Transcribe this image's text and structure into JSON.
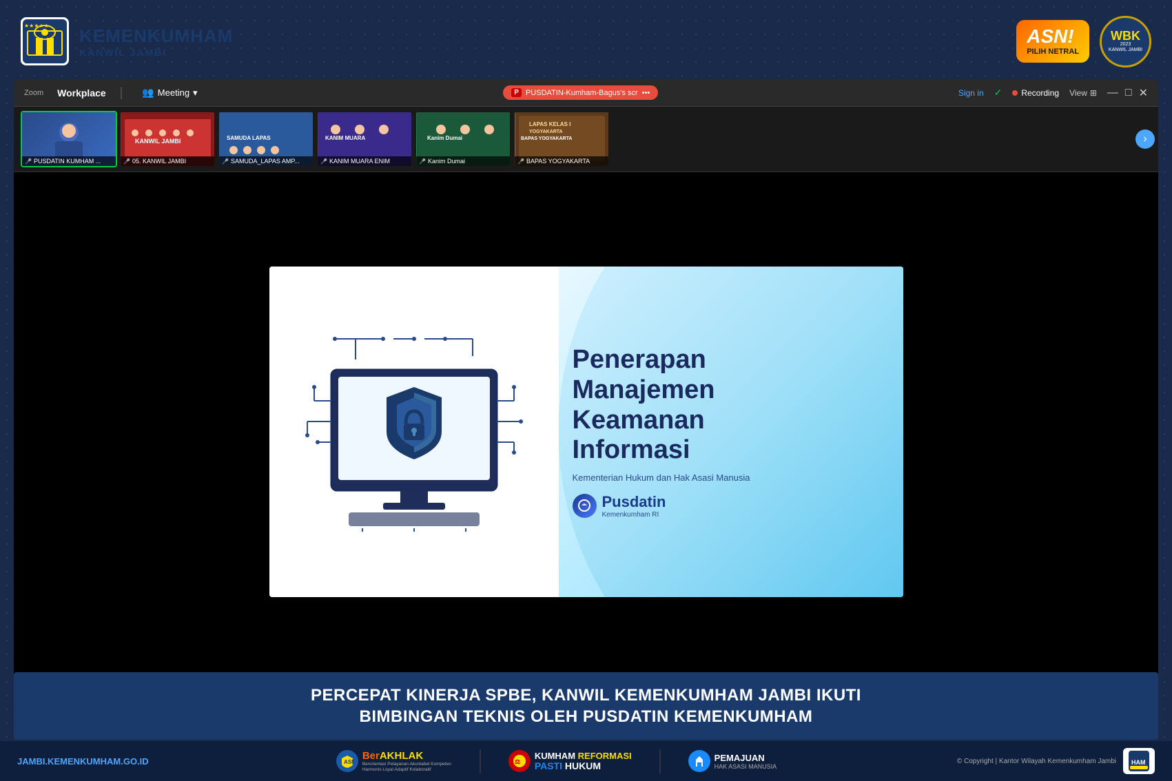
{
  "header": {
    "logo_title": "KEMENKUMHAM",
    "logo_subtitle": "KANWIL JAMBI",
    "asn_label": "ASN!",
    "pilih_netral": "PILIH NETRAL",
    "wbk_label": "WBK",
    "wbk_year": "2023",
    "wbk_sub": "KANWIL JAMBI"
  },
  "zoom": {
    "app_name": "Zoom",
    "workplace_label": "Workplace",
    "meeting_label": "Meeting",
    "shared_screen_label": "PUSDATIN-Kumham-Bagus's scr",
    "sign_in_label": "Sign in",
    "recording_label": "Recording",
    "view_label": "View",
    "chevron_down": "▾"
  },
  "participants": [
    {
      "id": 1,
      "name": "PUSDATIN KUMHAM ...",
      "active": true,
      "color": "p1-bg"
    },
    {
      "id": 2,
      "name": "05. KANWIL JAMBI",
      "active": false,
      "color": "p2-bg"
    },
    {
      "id": 3,
      "name": "SAMUDA_LAPAS AMP...",
      "active": false,
      "color": "p3-bg"
    },
    {
      "id": 4,
      "name": "KANIM MUARA ENIM",
      "active": false,
      "color": "p4-bg"
    },
    {
      "id": 5,
      "name": "Kanim Dumai",
      "active": false,
      "color": "p5-bg"
    },
    {
      "id": 6,
      "name": "BAPAS YOGYAKARTA",
      "active": false,
      "color": "p6-bg"
    }
  ],
  "slide": {
    "title_line1": "Penerapan",
    "title_line2": "Manajemen",
    "title_line3": "Keamanan",
    "title_line4": "Informasi",
    "subtitle": "Kementerian Hukum dan Hak Asasi Manusia",
    "brand_name": "Pusdatin",
    "brand_sub": "Kemenkumham RI"
  },
  "bottom_bar": {
    "line1": "PERCEPAT KINERJA SPBE, KANWIL KEMENKUMHAM JAMBI IKUTI",
    "line2": "BIMBINGAN TEKNIS OLEH PUSDATIN KEMENKUMHAM"
  },
  "footer": {
    "website": "JAMBI.KEMENKUMHAM.GO.ID",
    "berakhlak_label": "BerAKHLAK",
    "berakhlak_sub": "Berorientasi Pelayanan Akuntabel Kompeten Harmonis Loyal Adaptif Kolaboratif",
    "kumham_label": "KUMHAM",
    "reformasi_label": "REFORMASI",
    "pasti_label": "PASTI",
    "hukum_label": "HUKUM",
    "pemajuan_label": "PEMAJUAN",
    "hak_asasi_label": "HAK ASASI MANUSIA",
    "copyright": "© Copyright | Kantor Wilayah Kemenkumham Jambi"
  }
}
